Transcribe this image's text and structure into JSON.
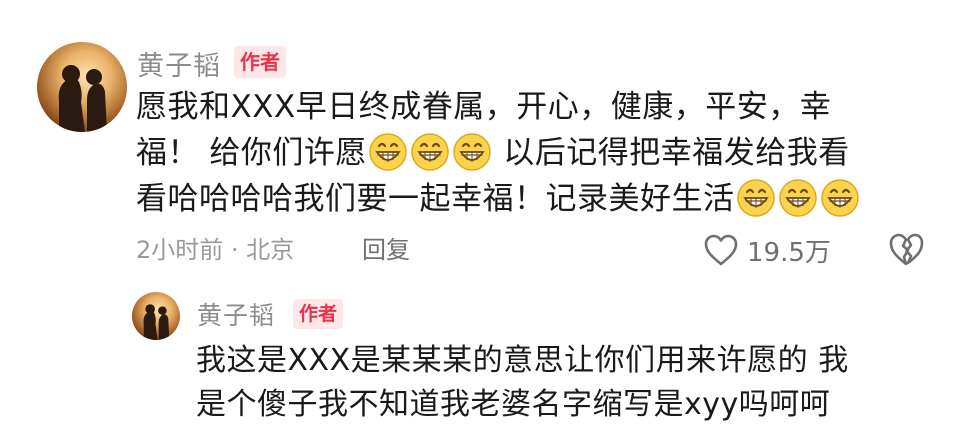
{
  "comment": {
    "author": "黄子韬",
    "badge": "作者",
    "lines": [
      [
        "愿我和XXX早日终成眷属，开心，健康，平安，幸"
      ],
      [
        "福！ 给你们许愿",
        {
          "emoji": "grinning-face",
          "count": 3
        },
        " 以后记得把幸福发给我看"
      ],
      [
        "看哈哈哈哈我们要一起幸福！记录美好生活",
        {
          "emoji": "grinning-face",
          "count": 3
        }
      ]
    ],
    "line1": "愿我和XXX早日终成眷属，开心，健康，平安，幸",
    "line2_a": "福！ 给你们许愿",
    "line2_b": " 以后记得把幸福发给我看",
    "line3_a": "看哈哈哈哈我们要一起幸福！记录美好生活",
    "time_location": "2小时前 · 北京",
    "reply_label": "回复",
    "like_count": "19.5万",
    "icons": {
      "like": "heart-outline-icon",
      "dislike": "broken-heart-icon",
      "emoji": "grinning-face-emoji"
    }
  },
  "reply": {
    "author": "黄子韬",
    "badge": "作者",
    "line1": "我这是XXX是某某某的意思让你们用来许愿的 我",
    "line2": "是个傻子我不知道我老婆名字缩写是xyy吗呵呵"
  },
  "colors": {
    "badge_bg": "#fde7e9",
    "badge_text": "#e8344a",
    "username": "#8c8c8c",
    "meta": "#9a9a9a",
    "emoji_face": "#fcd34d"
  }
}
